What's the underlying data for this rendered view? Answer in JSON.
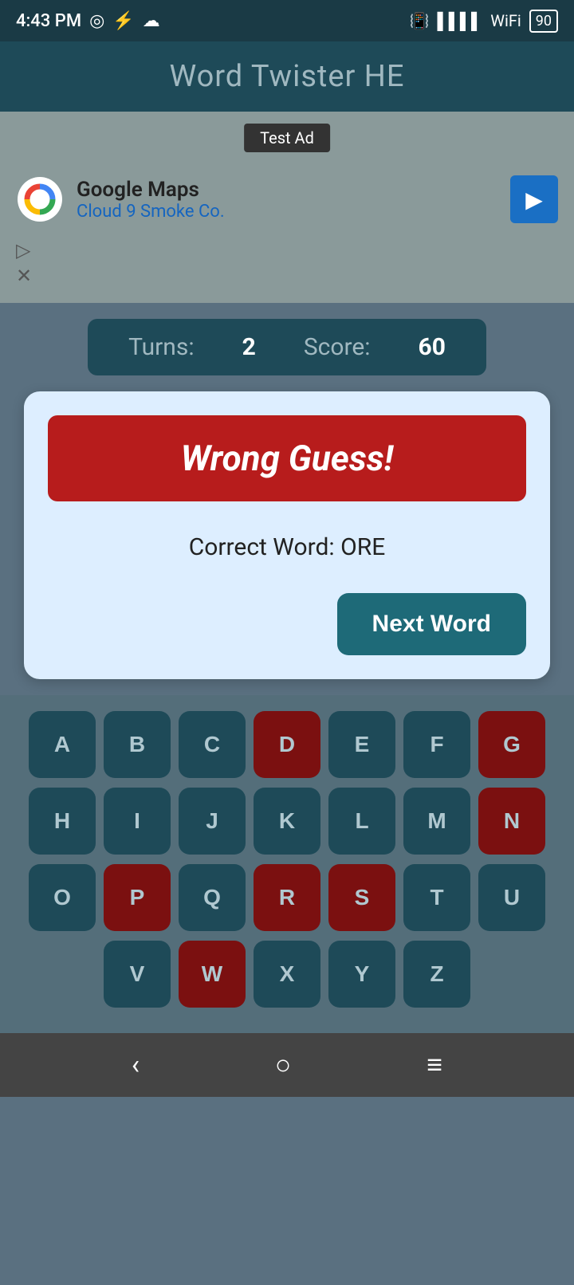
{
  "status_bar": {
    "time": "4:43 PM",
    "battery": "90"
  },
  "header": {
    "title": "Word Twister HE"
  },
  "ad": {
    "label": "Test Ad",
    "company": "Google Maps",
    "subtitle": "Cloud 9 Smoke Co.",
    "arrow": "▶"
  },
  "score_bar": {
    "turns_label": "Turns:",
    "turns_value": "2",
    "score_label": "Score:",
    "score_value": "60"
  },
  "dialog": {
    "wrong_guess_label": "Wrong Guess!",
    "correct_word_prefix": "Correct Word: ",
    "correct_word": "ORE",
    "next_word_label": "Next Word"
  },
  "keyboard": {
    "rows": [
      [
        {
          "letter": "A",
          "used": false
        },
        {
          "letter": "B",
          "used": false
        },
        {
          "letter": "C",
          "used": false
        },
        {
          "letter": "D",
          "used": true
        },
        {
          "letter": "E",
          "used": false
        },
        {
          "letter": "F",
          "used": false
        },
        {
          "letter": "G",
          "used": true
        }
      ],
      [
        {
          "letter": "H",
          "used": false
        },
        {
          "letter": "I",
          "used": false
        },
        {
          "letter": "J",
          "used": false
        },
        {
          "letter": "K",
          "used": false
        },
        {
          "letter": "L",
          "used": false
        },
        {
          "letter": "M",
          "used": false
        },
        {
          "letter": "N",
          "used": true
        }
      ],
      [
        {
          "letter": "O",
          "used": false
        },
        {
          "letter": "P",
          "used": true
        },
        {
          "letter": "Q",
          "used": false
        },
        {
          "letter": "R",
          "used": true
        },
        {
          "letter": "S",
          "used": true
        },
        {
          "letter": "T",
          "used": false
        },
        {
          "letter": "U",
          "used": false
        }
      ],
      [
        {
          "letter": "V",
          "used": false
        },
        {
          "letter": "W",
          "used": true
        },
        {
          "letter": "X",
          "used": false
        },
        {
          "letter": "Y",
          "used": false
        },
        {
          "letter": "Z",
          "used": false
        }
      ]
    ]
  },
  "nav": {
    "back": "‹",
    "home": "○",
    "menu": "≡"
  }
}
